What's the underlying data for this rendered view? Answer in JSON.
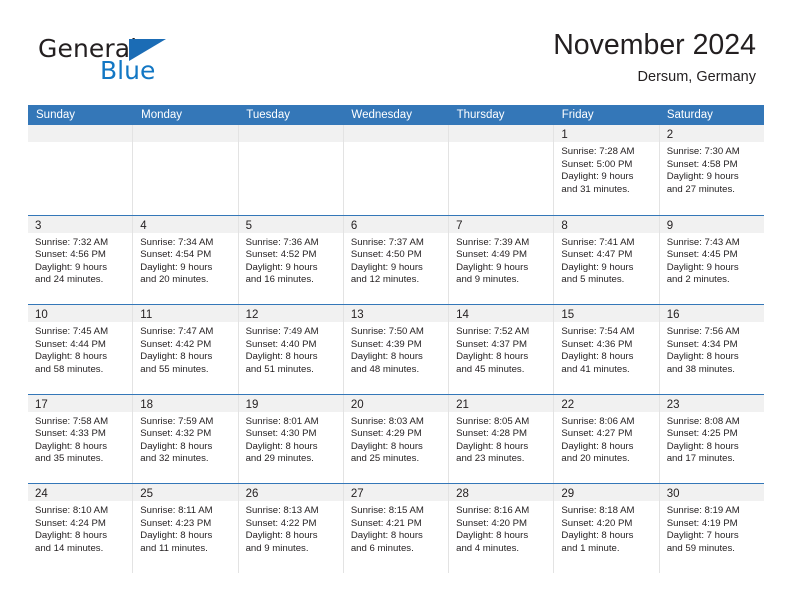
{
  "brand": {
    "name_part1": "General",
    "name_part2": "Blue",
    "flag_color": "#1b6cb5",
    "blue_color": "#1277c4"
  },
  "header": {
    "title": "November 2024",
    "subtitle": "Dersum, Germany",
    "accent_color": "#3477b8",
    "band_color": "#f1f1f1"
  },
  "weekday_headers": [
    "Sunday",
    "Monday",
    "Tuesday",
    "Wednesday",
    "Thursday",
    "Friday",
    "Saturday"
  ],
  "weeks": [
    [
      {
        "day": "",
        "empty": true
      },
      {
        "day": "",
        "empty": true
      },
      {
        "day": "",
        "empty": true
      },
      {
        "day": "",
        "empty": true
      },
      {
        "day": "",
        "empty": true
      },
      {
        "day": "1",
        "sunrise": "Sunrise: 7:28 AM",
        "sunset": "Sunset: 5:00 PM",
        "daylight1": "Daylight: 9 hours",
        "daylight2": "and 31 minutes."
      },
      {
        "day": "2",
        "sunrise": "Sunrise: 7:30 AM",
        "sunset": "Sunset: 4:58 PM",
        "daylight1": "Daylight: 9 hours",
        "daylight2": "and 27 minutes."
      }
    ],
    [
      {
        "day": "3",
        "sunrise": "Sunrise: 7:32 AM",
        "sunset": "Sunset: 4:56 PM",
        "daylight1": "Daylight: 9 hours",
        "daylight2": "and 24 minutes."
      },
      {
        "day": "4",
        "sunrise": "Sunrise: 7:34 AM",
        "sunset": "Sunset: 4:54 PM",
        "daylight1": "Daylight: 9 hours",
        "daylight2": "and 20 minutes."
      },
      {
        "day": "5",
        "sunrise": "Sunrise: 7:36 AM",
        "sunset": "Sunset: 4:52 PM",
        "daylight1": "Daylight: 9 hours",
        "daylight2": "and 16 minutes."
      },
      {
        "day": "6",
        "sunrise": "Sunrise: 7:37 AM",
        "sunset": "Sunset: 4:50 PM",
        "daylight1": "Daylight: 9 hours",
        "daylight2": "and 12 minutes."
      },
      {
        "day": "7",
        "sunrise": "Sunrise: 7:39 AM",
        "sunset": "Sunset: 4:49 PM",
        "daylight1": "Daylight: 9 hours",
        "daylight2": "and 9 minutes."
      },
      {
        "day": "8",
        "sunrise": "Sunrise: 7:41 AM",
        "sunset": "Sunset: 4:47 PM",
        "daylight1": "Daylight: 9 hours",
        "daylight2": "and 5 minutes."
      },
      {
        "day": "9",
        "sunrise": "Sunrise: 7:43 AM",
        "sunset": "Sunset: 4:45 PM",
        "daylight1": "Daylight: 9 hours",
        "daylight2": "and 2 minutes."
      }
    ],
    [
      {
        "day": "10",
        "sunrise": "Sunrise: 7:45 AM",
        "sunset": "Sunset: 4:44 PM",
        "daylight1": "Daylight: 8 hours",
        "daylight2": "and 58 minutes."
      },
      {
        "day": "11",
        "sunrise": "Sunrise: 7:47 AM",
        "sunset": "Sunset: 4:42 PM",
        "daylight1": "Daylight: 8 hours",
        "daylight2": "and 55 minutes."
      },
      {
        "day": "12",
        "sunrise": "Sunrise: 7:49 AM",
        "sunset": "Sunset: 4:40 PM",
        "daylight1": "Daylight: 8 hours",
        "daylight2": "and 51 minutes."
      },
      {
        "day": "13",
        "sunrise": "Sunrise: 7:50 AM",
        "sunset": "Sunset: 4:39 PM",
        "daylight1": "Daylight: 8 hours",
        "daylight2": "and 48 minutes."
      },
      {
        "day": "14",
        "sunrise": "Sunrise: 7:52 AM",
        "sunset": "Sunset: 4:37 PM",
        "daylight1": "Daylight: 8 hours",
        "daylight2": "and 45 minutes."
      },
      {
        "day": "15",
        "sunrise": "Sunrise: 7:54 AM",
        "sunset": "Sunset: 4:36 PM",
        "daylight1": "Daylight: 8 hours",
        "daylight2": "and 41 minutes."
      },
      {
        "day": "16",
        "sunrise": "Sunrise: 7:56 AM",
        "sunset": "Sunset: 4:34 PM",
        "daylight1": "Daylight: 8 hours",
        "daylight2": "and 38 minutes."
      }
    ],
    [
      {
        "day": "17",
        "sunrise": "Sunrise: 7:58 AM",
        "sunset": "Sunset: 4:33 PM",
        "daylight1": "Daylight: 8 hours",
        "daylight2": "and 35 minutes."
      },
      {
        "day": "18",
        "sunrise": "Sunrise: 7:59 AM",
        "sunset": "Sunset: 4:32 PM",
        "daylight1": "Daylight: 8 hours",
        "daylight2": "and 32 minutes."
      },
      {
        "day": "19",
        "sunrise": "Sunrise: 8:01 AM",
        "sunset": "Sunset: 4:30 PM",
        "daylight1": "Daylight: 8 hours",
        "daylight2": "and 29 minutes."
      },
      {
        "day": "20",
        "sunrise": "Sunrise: 8:03 AM",
        "sunset": "Sunset: 4:29 PM",
        "daylight1": "Daylight: 8 hours",
        "daylight2": "and 25 minutes."
      },
      {
        "day": "21",
        "sunrise": "Sunrise: 8:05 AM",
        "sunset": "Sunset: 4:28 PM",
        "daylight1": "Daylight: 8 hours",
        "daylight2": "and 23 minutes."
      },
      {
        "day": "22",
        "sunrise": "Sunrise: 8:06 AM",
        "sunset": "Sunset: 4:27 PM",
        "daylight1": "Daylight: 8 hours",
        "daylight2": "and 20 minutes."
      },
      {
        "day": "23",
        "sunrise": "Sunrise: 8:08 AM",
        "sunset": "Sunset: 4:25 PM",
        "daylight1": "Daylight: 8 hours",
        "daylight2": "and 17 minutes."
      }
    ],
    [
      {
        "day": "24",
        "sunrise": "Sunrise: 8:10 AM",
        "sunset": "Sunset: 4:24 PM",
        "daylight1": "Daylight: 8 hours",
        "daylight2": "and 14 minutes."
      },
      {
        "day": "25",
        "sunrise": "Sunrise: 8:11 AM",
        "sunset": "Sunset: 4:23 PM",
        "daylight1": "Daylight: 8 hours",
        "daylight2": "and 11 minutes."
      },
      {
        "day": "26",
        "sunrise": "Sunrise: 8:13 AM",
        "sunset": "Sunset: 4:22 PM",
        "daylight1": "Daylight: 8 hours",
        "daylight2": "and 9 minutes."
      },
      {
        "day": "27",
        "sunrise": "Sunrise: 8:15 AM",
        "sunset": "Sunset: 4:21 PM",
        "daylight1": "Daylight: 8 hours",
        "daylight2": "and 6 minutes."
      },
      {
        "day": "28",
        "sunrise": "Sunrise: 8:16 AM",
        "sunset": "Sunset: 4:20 PM",
        "daylight1": "Daylight: 8 hours",
        "daylight2": "and 4 minutes."
      },
      {
        "day": "29",
        "sunrise": "Sunrise: 8:18 AM",
        "sunset": "Sunset: 4:20 PM",
        "daylight1": "Daylight: 8 hours",
        "daylight2": "and 1 minute."
      },
      {
        "day": "30",
        "sunrise": "Sunrise: 8:19 AM",
        "sunset": "Sunset: 4:19 PM",
        "daylight1": "Daylight: 7 hours",
        "daylight2": "and 59 minutes."
      }
    ]
  ]
}
